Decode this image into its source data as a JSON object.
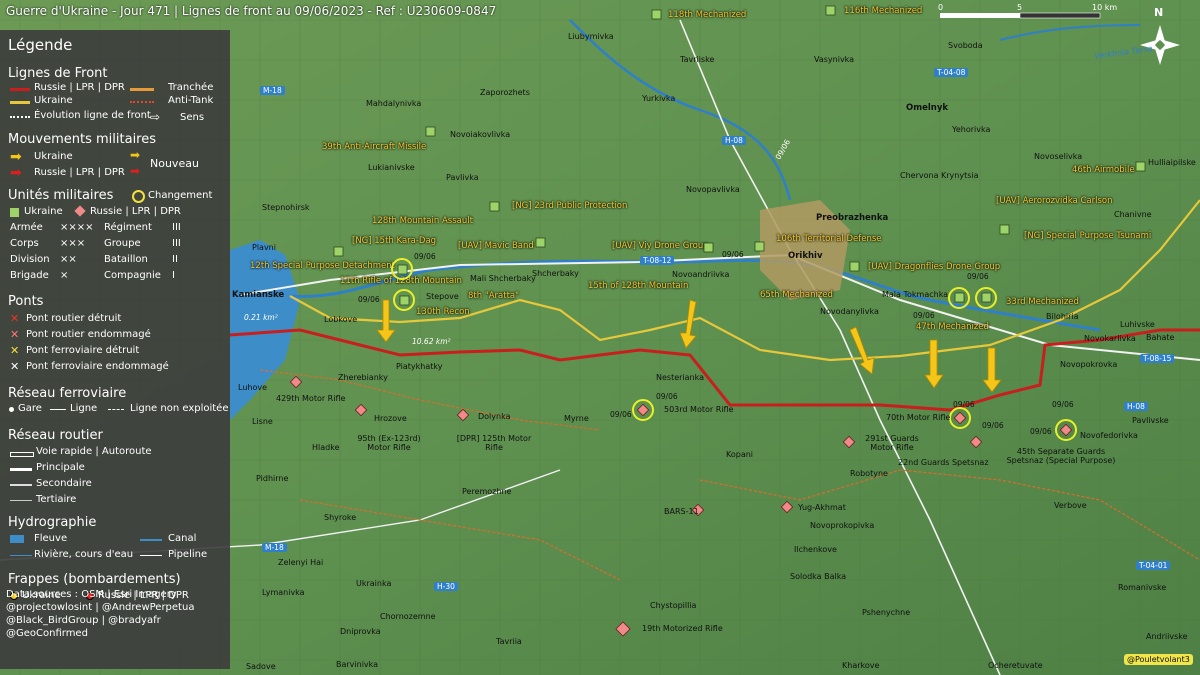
{
  "title": "Guerre d'Ukraine - Jour 471 | Lignes de front au 09/06/2023 - Ref : U230609-0847",
  "legend": {
    "title": "Légende",
    "front_lines": {
      "heading": "Lignes de Front",
      "russia": "Russie | LPR | DPR",
      "ukraine": "Ukraine",
      "evolution": "Évolution ligne de front",
      "trench": "Tranchée",
      "antitank": "Anti-Tank",
      "direction": "Sens"
    },
    "movements": {
      "heading": "Mouvements militaires",
      "ukraine": "Ukraine",
      "russia": "Russie | LPR | DPR",
      "new": "Nouveau"
    },
    "units": {
      "heading": "Unités militaires",
      "change": "Changement",
      "ukraine": "Ukraine",
      "russia": "Russie | LPR | DPR",
      "rows": [
        {
          "a": "Armée",
          "as": "××××",
          "b": "Régiment",
          "bs": "III"
        },
        {
          "a": "Corps",
          "as": "×××",
          "b": "Groupe",
          "bs": "III"
        },
        {
          "a": "Division",
          "as": "××",
          "b": "Bataillon",
          "bs": "II"
        },
        {
          "a": "Brigade",
          "as": "×",
          "b": "Compagnie",
          "bs": "I"
        }
      ]
    },
    "bridges": {
      "heading": "Ponts",
      "items": [
        "Pont routier détruit",
        "Pont routier endommagé",
        "Pont ferroviaire détruit",
        "Pont ferroviaire endommagé"
      ]
    },
    "rail": {
      "heading": "Réseau ferroviaire",
      "station": "Gare",
      "line": "Ligne",
      "unused": "Ligne non exploitée"
    },
    "roads": {
      "heading": "Réseau routier",
      "items": [
        "Voie rapide | Autoroute",
        "Principale",
        "Secondaire",
        "Tertiaire"
      ]
    },
    "hydro": {
      "heading": "Hydrographie",
      "river_big": "Fleuve",
      "canal": "Canal",
      "river": "Rivière, cours d'eau",
      "pipeline": "Pipeline"
    },
    "strikes": {
      "heading": "Frappes (bombardements)",
      "ukraine": "Ukraine",
      "russia": "Russie | LPR | DPR"
    }
  },
  "credits": [
    "Data sources : OSM | Esri Imagery",
    "@projectowlosint | @AndrewPerpetua",
    "@Black_BirdGroup | @bradyafr",
    "@GeoConfirmed"
  ],
  "watermark": "@Pouletvolant3",
  "scale": {
    "zero": "0",
    "mid": "5",
    "end": "10 km"
  },
  "north": "N",
  "ua_units": [
    "118th Mechanized",
    "116th Mechanized",
    "39th Anti-Aircraft Missile",
    "128th Mountain Assault",
    "[NG] 23rd Public Protection",
    "[NG] 15th Kara-Dag",
    "[UAV] Mavic Band",
    "[UAV] Viy Drone Group",
    "106th Territorial Defense",
    "12th Special Purpose Detachment",
    "11th Rifle of 128th Mountain",
    "8th \"Aratta\"",
    "130th Recon",
    "15th of 128th Mountain",
    "65th Mechanized",
    "[UAV] Dragonflies Drone Group",
    "33rd Mechanized",
    "47th Mechanized",
    "46th Airmobile",
    "[UAV] Aerorozvidka Carlson",
    "[NG] Special Purpose Tsunami"
  ],
  "ru_units": [
    "429th Motor Rifle",
    "95th (Ex-123rd) Motor Rifle",
    "[DPR] 125th Motor Rifle",
    "503rd Motor Rifle",
    "70th Motor Rifle",
    "291st Guards Motor Rifle",
    "22nd Guards Spetsnaz",
    "45th Separate Guards Spetsnaz (Special Purpose)",
    "BARS-11",
    "Yug-Akhmat",
    "19th Motorized Rifle"
  ],
  "dates": [
    "09/06",
    "09/06",
    "09/06",
    "09/06",
    "09/06",
    "09/06",
    "09/06",
    "09/06",
    "09/06",
    "09/06",
    "09/06"
  ],
  "places": {
    "bold": [
      "Kamianske",
      "Orikhiv",
      "Omelnyk",
      "Preobrazhenka"
    ],
    "normal": [
      "Liubymivka",
      "Tavriiske",
      "Vasynivka",
      "Svoboda",
      "Yurkivka",
      "Zaporozhets",
      "Mahdalynivka",
      "Novoiakovlivka",
      "Yehorivka",
      "Novoselivka",
      "Hulliaipilske",
      "Lukianivske",
      "Pavlivka",
      "Novopavlivka",
      "Chervona Krynytsia",
      "Stepnohirsk",
      "Plavni",
      "Chanivne",
      "Mali Shcherbaky",
      "Shcherbaky",
      "Novoandriivka",
      "Mala Tokmachka",
      "Stepove",
      "Lobkove",
      "Novodanylivka",
      "Luhivske",
      "Bilohiria",
      "Bahate",
      "Novokarlivka",
      "Zherebianky",
      "Piatykhatky",
      "Nesterianka",
      "Novopokrovka",
      "Luhove",
      "Hrozove",
      "Dolynka",
      "Myrne",
      "Pavlivske",
      "Lisne",
      "Hladke",
      "Kopani",
      "Novofedorivka",
      "Robotyne",
      "Pidhirne",
      "Peremozhne",
      "Verbove",
      "Shyroke",
      "Novoprokopivka",
      "Ilchenkove",
      "Zelenyi Hai",
      "Ukrainka",
      "Solodka Balka",
      "Lymanivka",
      "Romanivske",
      "Chornozemne",
      "Chystopillia",
      "Pshenychne",
      "Dniprovka",
      "Tavriia",
      "Andriivske",
      "Barvinivka",
      "Sadove",
      "Kharkove",
      "Ocheretuvate",
      "Verkhnia Tersa"
    ]
  },
  "roads": [
    "M-18",
    "M-18",
    "H-08",
    "T-04-08",
    "T-08-12",
    "T-08-15",
    "H-08",
    "H-30",
    "T-04-01",
    "T-08-15"
  ],
  "annotations": {
    "area1": "0.21 km²",
    "area2": "10.62 km²",
    "road_label": "09/06"
  }
}
